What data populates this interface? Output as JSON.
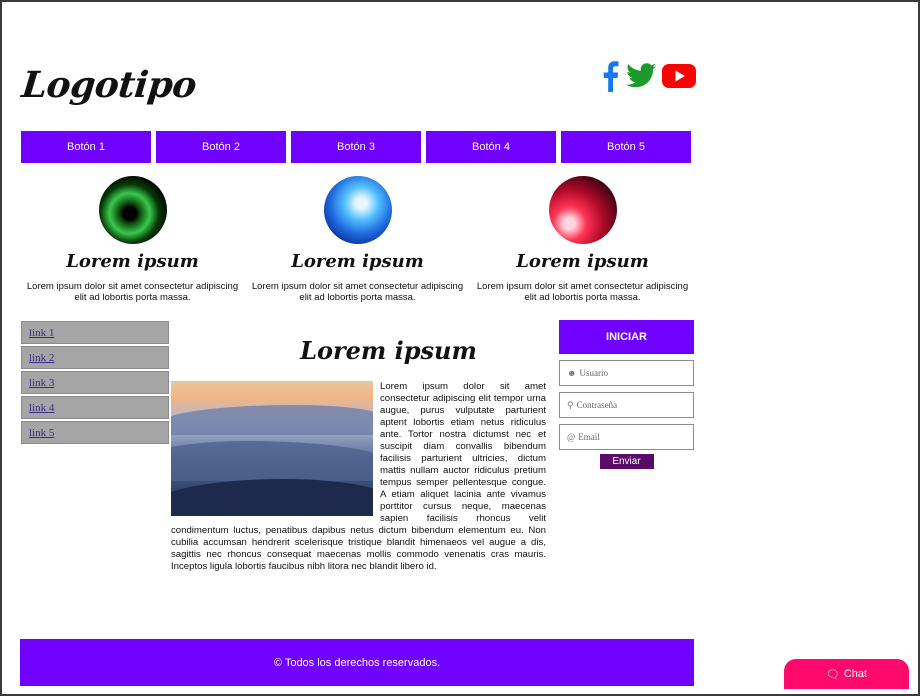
{
  "header": {
    "logo": "Logotipo"
  },
  "social": {
    "icons": [
      "facebook-icon",
      "twitter-icon",
      "youtube-icon"
    ],
    "colors": {
      "facebook": "#1877f2",
      "twitter": "#1a9a2a",
      "youtube": "#ff0000"
    }
  },
  "nav": {
    "buttons": [
      "Botón 1",
      "Botón 2",
      "Botón 3",
      "Botón 4",
      "Botón 5"
    ]
  },
  "features": [
    {
      "title": "Lorem ipsum",
      "text": "Lorem ipsum dolor sit amet consectetur adipiscing elit ad lobortis porta massa."
    },
    {
      "title": "Lorem ipsum",
      "text": "Lorem ipsum dolor sit amet consectetur adipiscing elit ad lobortis porta massa."
    },
    {
      "title": "Lorem ipsum",
      "text": "Lorem ipsum dolor sit amet consectetur adipiscing elit ad lobortis porta massa."
    }
  ],
  "sidebar": {
    "links": [
      "link 1",
      "link 2",
      "link 3",
      "link 4",
      "link 5"
    ]
  },
  "main": {
    "title": "Lorem ipsum",
    "text": "Lorem ipsum dolor sit amet consectetur adipiscing elit tempor urna augue, purus vulputate parturient aptent lobortis etiam netus ridiculus ante. Tortor nostra dictumst nec et suscipit diam convallis bibendum facilisis parturient ultricies, dictum mattis nullam auctor ridiculus pretium tempus semper pellentesque congue. A etiam aliquet lacinia ante vivamus porttitor cursus neque, maecenas sapien facilisis rhoncus velit condimentum luctus, penatibus dapibus netus dictum bibendum elementum eu. Non cubilia accumsan hendrerit scelerisque tristique blandit himenaeos vel augue a dis, sagittis nec rhoncus consequat maecenas mollis commodo venenatis cras mauris. Inceptos ligula lobortis faucibus nibh litora nec blandit libero id."
  },
  "login": {
    "title": "INICIAR",
    "user_placeholder": "Usuario",
    "password_placeholder": "Contraseña",
    "email_placeholder": "Email",
    "submit_label": "Enviar"
  },
  "footer": {
    "text": "© Todos los derechos reservados."
  },
  "chat": {
    "label": "Chat"
  },
  "colors": {
    "accent": "#7000ff",
    "chat": "#ff0a6c",
    "submit": "#5a0a6a",
    "sidebar": "#a5a5a5"
  }
}
